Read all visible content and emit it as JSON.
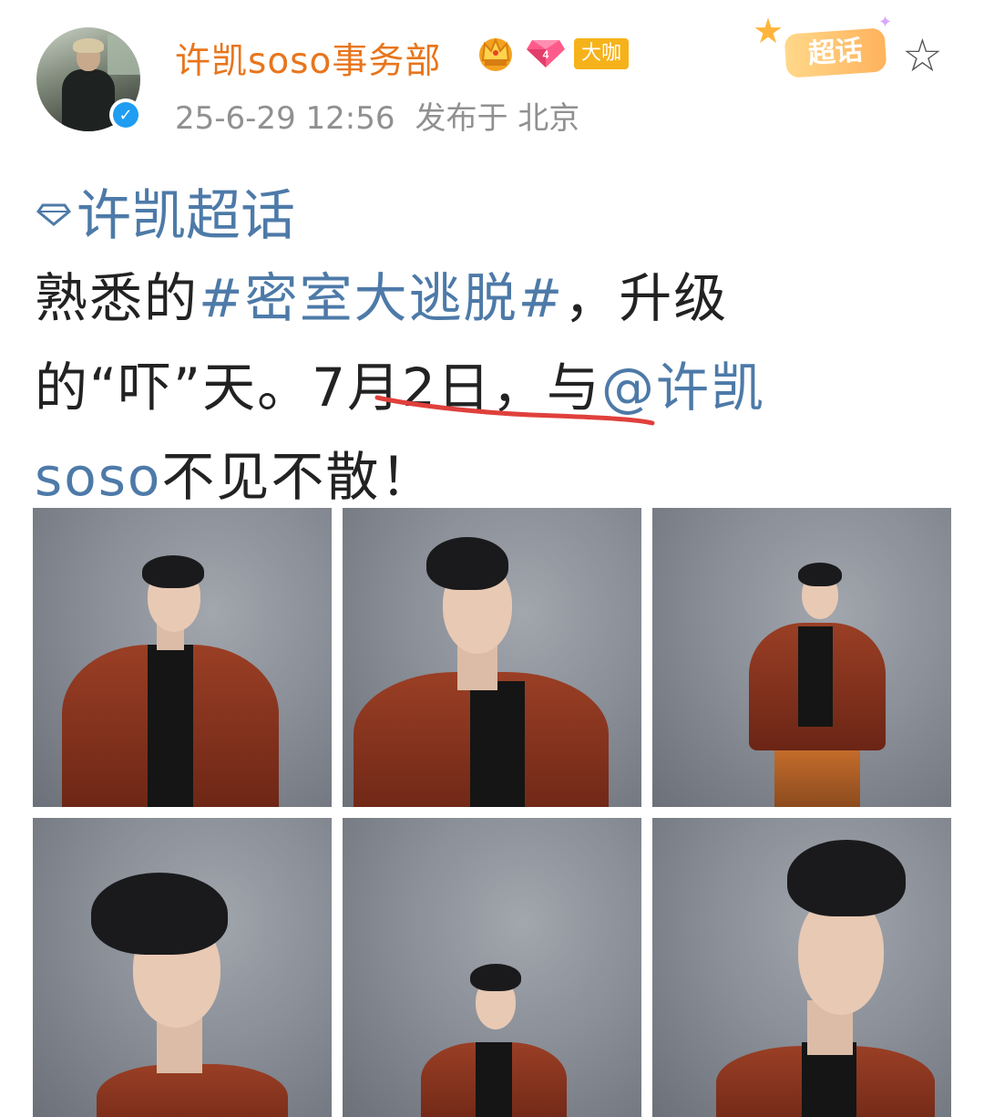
{
  "header": {
    "username": "许凯soso事务部",
    "verified_badge": "✓",
    "level_badge": "大咖",
    "timestamp": "25-6-29 12:56",
    "location_text": "发布于 北京",
    "chaohua_label": "超话"
  },
  "post": {
    "topic_tag": "许凯超话",
    "line1_prefix": "熟悉的",
    "line1_hashtag": "#密室大逃脱#",
    "line1_suffix": "，升级",
    "line2_prefix": "的“吓”天。",
    "line2_date": "7月2日，",
    "line2_mid": "与",
    "line2_mention": "@许凯",
    "line3_mention": "soso",
    "line3_suffix": "不见不散！"
  },
  "colors": {
    "username": "#e8751c",
    "link": "#4d7aa8",
    "meta": "#909090",
    "underline": "#e0403c",
    "verified": "#1e9df2"
  },
  "icons": [
    "crown-badge-icon",
    "gem-badge-icon",
    "star-icon",
    "diamond-topic-icon",
    "verified-icon"
  ],
  "photos": [
    {
      "label": "photo-1"
    },
    {
      "label": "photo-2"
    },
    {
      "label": "photo-3"
    },
    {
      "label": "photo-4"
    },
    {
      "label": "photo-5"
    },
    {
      "label": "photo-6"
    }
  ]
}
